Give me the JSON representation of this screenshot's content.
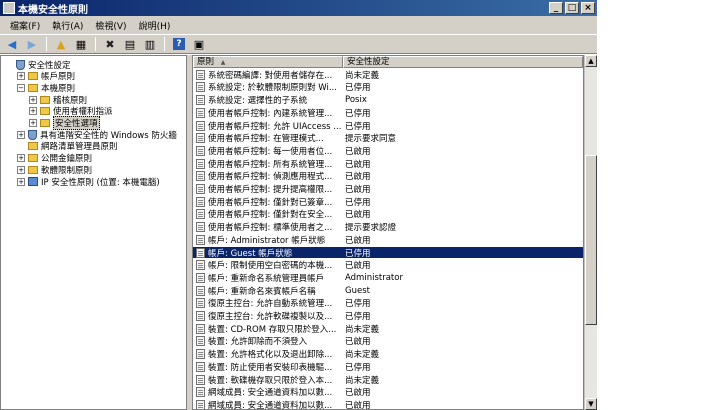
{
  "window": {
    "title": "本機安全性原則"
  },
  "window_buttons": {
    "minimize": "_",
    "maximize": "□",
    "close": "×"
  },
  "menu": [
    "檔案(F)",
    "執行(A)",
    "檢視(V)",
    "說明(H)"
  ],
  "toolbar_icons": [
    "back-arrow-icon",
    "forward-arrow-icon",
    "up-folder-icon",
    "show-tree-icon",
    "delete-icon",
    "properties-icon",
    "export-icon",
    "help-icon",
    "panel-icon"
  ],
  "tree": [
    {
      "label": "安全性設定",
      "level": 0,
      "icon": "shield",
      "expander": ""
    },
    {
      "label": "帳戶原則",
      "level": 1,
      "icon": "folder",
      "expander": "+"
    },
    {
      "label": "本機原則",
      "level": 1,
      "icon": "folder",
      "expander": "−"
    },
    {
      "label": "稽核原則",
      "level": 2,
      "icon": "folder",
      "expander": "+"
    },
    {
      "label": "使用者權利指派",
      "level": 2,
      "icon": "folder",
      "expander": "+"
    },
    {
      "label": "安全性選項",
      "level": 2,
      "icon": "folder",
      "expander": "+",
      "selected": true
    },
    {
      "label": "具有進階安全性的 Windows 防火牆",
      "level": 1,
      "icon": "shield",
      "expander": "+"
    },
    {
      "label": "網路清單管理員原則",
      "level": 1,
      "icon": "folder",
      "expander": ""
    },
    {
      "label": "公開金鑰原則",
      "level": 1,
      "icon": "folder",
      "expander": "+"
    },
    {
      "label": "軟體限制原則",
      "level": 1,
      "icon": "folder",
      "expander": "+"
    },
    {
      "label": "IP 安全性原則 (位置: 本機電腦)",
      "level": 1,
      "icon": "net",
      "expander": "+"
    }
  ],
  "columns": {
    "policy": "原則",
    "sort": "▲",
    "setting": "安全性設定"
  },
  "rows": [
    {
      "policy": "系統密碼編譯: 對使用者儲存在...",
      "setting": "尚未定義"
    },
    {
      "policy": "系統設定: 於軟體限制原則對 Wi...",
      "setting": "已停用"
    },
    {
      "policy": "系統設定: 選擇性的子系統",
      "setting": "Posix"
    },
    {
      "policy": "使用者帳戶控制: 內建系統管理...",
      "setting": "已停用"
    },
    {
      "policy": "使用者帳戶控制: 允許 UIAccess ...",
      "setting": "已停用"
    },
    {
      "policy": "使用者帳戶控制: 在管理模式...",
      "setting": "提示要求同意"
    },
    {
      "policy": "使用者帳戶控制: 每一使用者位...",
      "setting": "已啟用"
    },
    {
      "policy": "使用者帳戶控制: 所有系統管理...",
      "setting": "已啟用"
    },
    {
      "policy": "使用者帳戶控制: 偵測應用程式...",
      "setting": "已啟用"
    },
    {
      "policy": "使用者帳戶控制: 提升提高權限...",
      "setting": "已啟用"
    },
    {
      "policy": "使用者帳戶控制: 僅針對已簽章...",
      "setting": "已停用"
    },
    {
      "policy": "使用者帳戶控制: 僅針對在安全...",
      "setting": "已啟用"
    },
    {
      "policy": "使用者帳戶控制: 標準使用者之...",
      "setting": "提示要求認證"
    },
    {
      "policy": "帳戶: Administrator 帳戶狀態",
      "setting": "已啟用"
    },
    {
      "policy": "帳戶: Guest 帳戶狀態",
      "setting": "已停用",
      "selected": true
    },
    {
      "policy": "帳戶: 限制使用空白密碼的本機...",
      "setting": "已啟用"
    },
    {
      "policy": "帳戶: 重新命名系統管理員帳戶",
      "setting": "Administrator"
    },
    {
      "policy": "帳戶: 重新命名來賓帳戶名稱",
      "setting": "Guest"
    },
    {
      "policy": "復原主控台: 允許自動系統管理...",
      "setting": "已停用"
    },
    {
      "policy": "復原主控台: 允許軟碟複製以及...",
      "setting": "已停用"
    },
    {
      "policy": "裝置: CD-ROM 存取只限於登入...",
      "setting": "尚未定義"
    },
    {
      "policy": "裝置: 允許卸除而不須登入",
      "setting": "已啟用"
    },
    {
      "policy": "裝置: 允許格式化以及退出卸除...",
      "setting": "尚未定義"
    },
    {
      "policy": "裝置: 防止使用者安裝印表機驅...",
      "setting": "已停用"
    },
    {
      "policy": "裝置: 軟碟機存取只限於登入本...",
      "setting": "尚未定義"
    },
    {
      "policy": "網域成員: 安全通道資料加以數...",
      "setting": "已啟用"
    },
    {
      "policy": "網域成員: 安全通道資料加以數...",
      "setting": "已啟用"
    }
  ],
  "scrollbar": {
    "up": "▲",
    "down": "▼"
  }
}
